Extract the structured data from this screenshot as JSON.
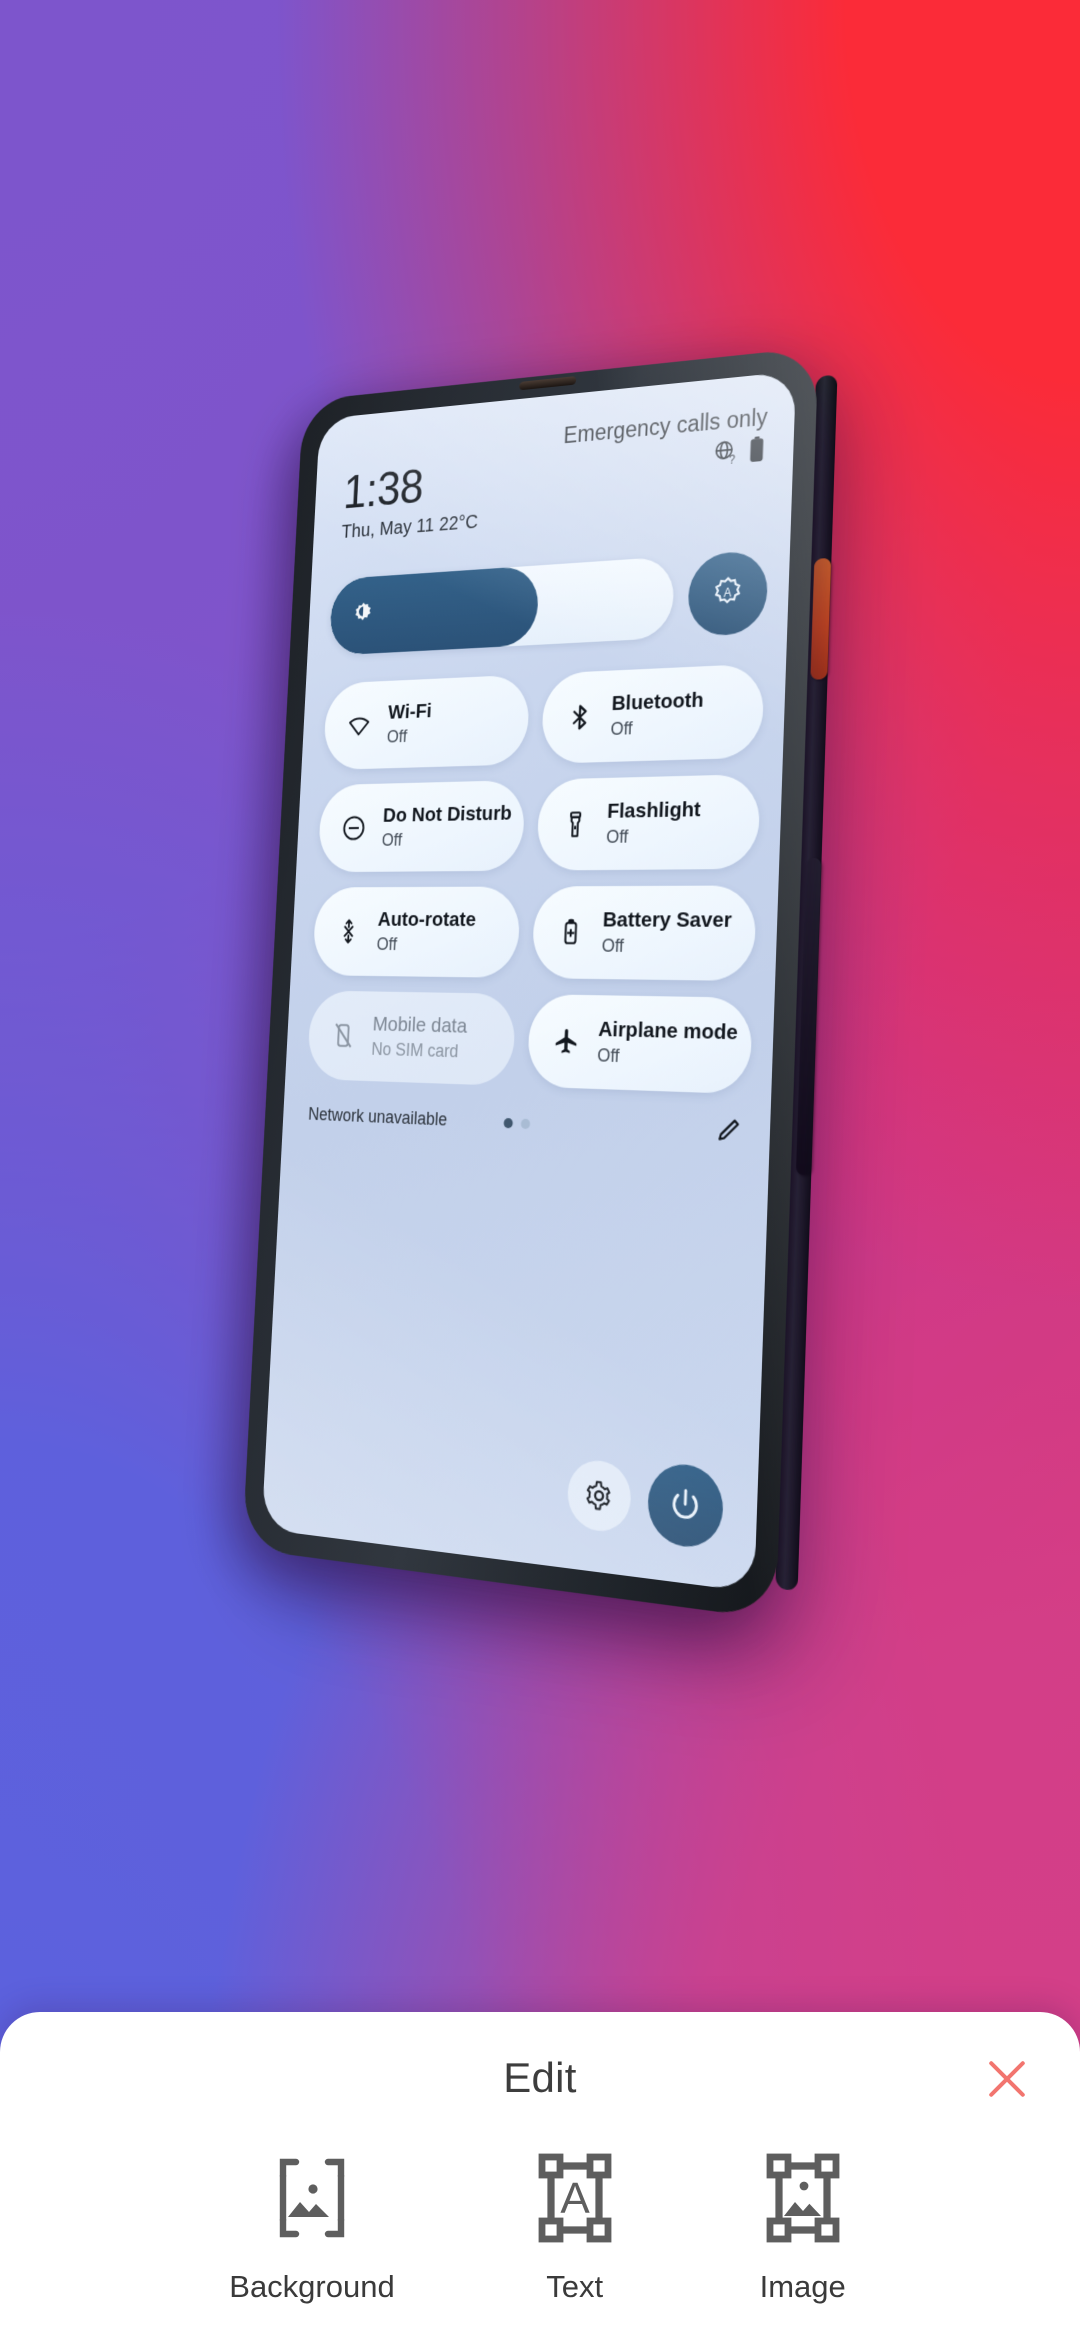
{
  "background": {
    "gradient_colors": [
      "#7d55cc",
      "#fb2b38",
      "#d2408b",
      "#5a62df"
    ]
  },
  "phone": {
    "hardware": {
      "power_button_color": "#e9561c",
      "volume_button_color": "#15181c",
      "frame_color": "#272c33"
    },
    "status_bar": {
      "carrier": "Emergency calls only",
      "icons": [
        "globe-question-icon",
        "battery-icon"
      ]
    },
    "clock": {
      "time": "1:38",
      "date": "Thu, May 11 22°C"
    },
    "brightness": {
      "icon": "brightness-icon",
      "level_percent": 62,
      "auto_button_icon": "auto-brightness-icon",
      "fill_color": "#2b5278"
    },
    "tiles": [
      {
        "icon": "wifi-icon",
        "title": "Wi-Fi",
        "status": "Off",
        "disabled": false
      },
      {
        "icon": "bluetooth-icon",
        "title": "Bluetooth",
        "status": "Off",
        "disabled": false
      },
      {
        "icon": "do-not-disturb-icon",
        "title": "Do Not Disturb",
        "status": "Off",
        "disabled": false
      },
      {
        "icon": "flashlight-icon",
        "title": "Flashlight",
        "status": "Off",
        "disabled": false
      },
      {
        "icon": "auto-rotate-icon",
        "title": "Auto-rotate",
        "status": "Off",
        "disabled": false
      },
      {
        "icon": "battery-saver-icon",
        "title": "Battery Saver",
        "status": "Off",
        "disabled": false
      },
      {
        "icon": "mobile-data-off-icon",
        "title": "Mobile data",
        "status": "No SIM card",
        "disabled": true
      },
      {
        "icon": "airplane-icon",
        "title": "Airplane mode",
        "status": "Off",
        "disabled": false
      }
    ],
    "footer": {
      "network_status": "Network unavailable",
      "pages": 2,
      "active_page": 1,
      "edit_icon": "pencil-icon"
    },
    "bottom_bar": {
      "settings_icon": "gear-icon",
      "power_icon": "power-icon"
    }
  },
  "edit_sheet": {
    "title": "Edit",
    "close_icon": "close-icon",
    "close_color": "#f2756f",
    "actions": [
      {
        "icon": "background-icon",
        "label": "Background"
      },
      {
        "icon": "text-icon",
        "label": "Text"
      },
      {
        "icon": "image-icon",
        "label": "Image"
      }
    ]
  }
}
